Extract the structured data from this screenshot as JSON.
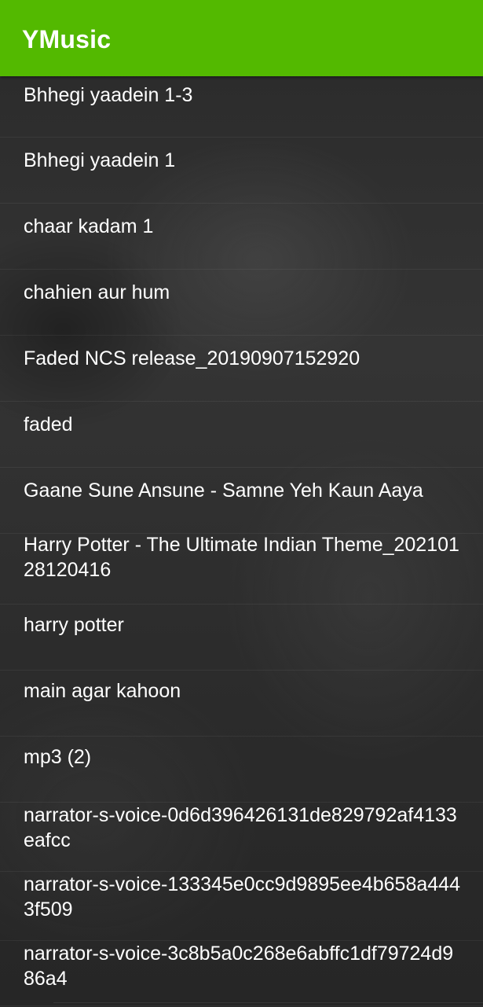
{
  "app_bar": {
    "title": "YMusic",
    "color": "#53b900"
  },
  "songs": [
    {
      "title": "Bhhegi yaadein 1-3"
    },
    {
      "title": "Bhhegi yaadein 1"
    },
    {
      "title": "chaar kadam 1"
    },
    {
      "title": "chahien aur hum"
    },
    {
      "title": "Faded NCS release_20190907152920"
    },
    {
      "title": "faded"
    },
    {
      "title": "Gaane Sune Ansune - Samne Yeh Kaun Aaya"
    },
    {
      "title": "Harry Potter - The Ultimate Indian Theme_20210128120416"
    },
    {
      "title": "harry potter"
    },
    {
      "title": "main agar kahoon"
    },
    {
      "title": "mp3 (2)"
    },
    {
      "title": "narrator-s-voice-0d6d396426131de829792af4133eafcc"
    },
    {
      "title": "narrator-s-voice-133345e0cc9d9895ee4b658a4443f509"
    },
    {
      "title": "narrator-s-voice-3c8b5a0c268e6abffc1df79724d986a4"
    }
  ]
}
